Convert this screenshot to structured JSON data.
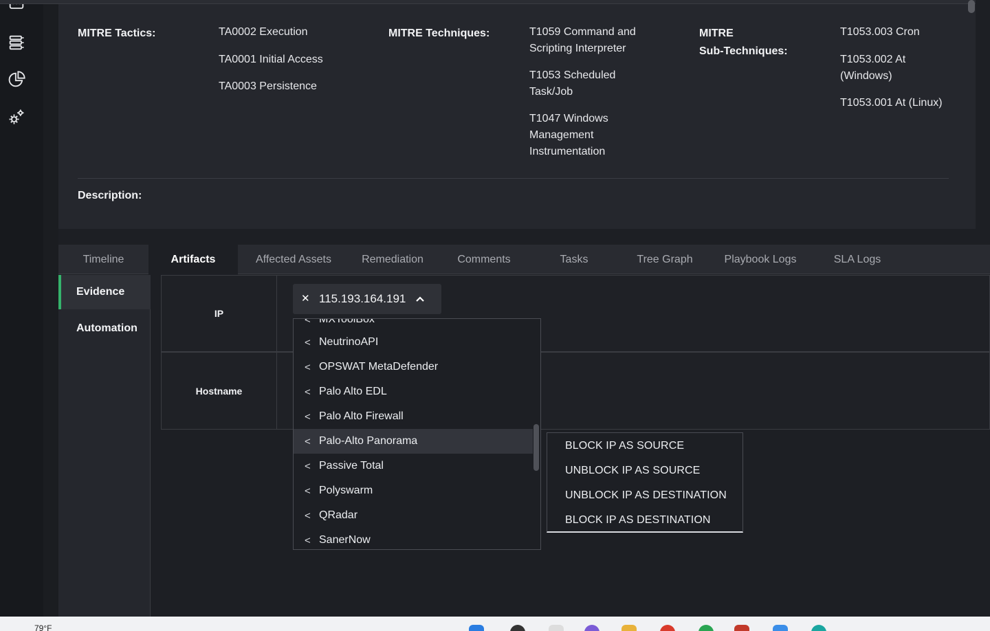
{
  "mitre": {
    "tactics_label": "MITRE Tactics:",
    "tactics": [
      "TA0002 Execution",
      "TA0001 Initial Access",
      "TA0003 Persistence"
    ],
    "techniques_label": "MITRE Techniques:",
    "techniques": [
      "T1059 Command and Scripting Interpreter",
      "T1053 Scheduled Task/Job",
      "T1047 Windows Management Instrumentation"
    ],
    "subtech_label_line1": "MITRE",
    "subtech_label_line2": "Sub-Techniques:",
    "subtechniques": [
      "T1053.003 Cron",
      "T1053.002 At (Windows)",
      "T1053.001 At (Linux)"
    ]
  },
  "description": {
    "label": "Description:"
  },
  "tabs": [
    {
      "label": "Timeline"
    },
    {
      "label": "Artifacts"
    },
    {
      "label": "Affected Assets"
    },
    {
      "label": "Remediation"
    },
    {
      "label": "Comments"
    },
    {
      "label": "Tasks"
    },
    {
      "label": "Tree Graph"
    },
    {
      "label": "Playbook Logs"
    },
    {
      "label": "SLA Logs"
    }
  ],
  "subtabs": [
    {
      "label": "Evidence"
    },
    {
      "label": "Automation"
    }
  ],
  "artifacts": {
    "rows": [
      {
        "key": "IP"
      },
      {
        "key": "Hostname"
      }
    ],
    "selected_ip": "115.193.164.191"
  },
  "dropdown": {
    "items": [
      "MXToolBox",
      "NeutrinoAPI",
      "OPSWAT MetaDefender",
      "Palo Alto EDL",
      "Palo Alto Firewall",
      "Palo-Alto Panorama",
      "Passive Total",
      "Polyswarm",
      "QRadar",
      "SanerNow"
    ],
    "highlighted_index": 5
  },
  "submenu": {
    "items": [
      "BLOCK IP AS SOURCE",
      "UNBLOCK IP AS SOURCE",
      "UNBLOCK IP AS DESTINATION",
      "BLOCK IP AS DESTINATION"
    ]
  },
  "taskbar": {
    "temperature": "79°F"
  },
  "colors": {
    "accent": "#35b36b",
    "bg": "#1d1f24",
    "panel": "#25272d"
  }
}
